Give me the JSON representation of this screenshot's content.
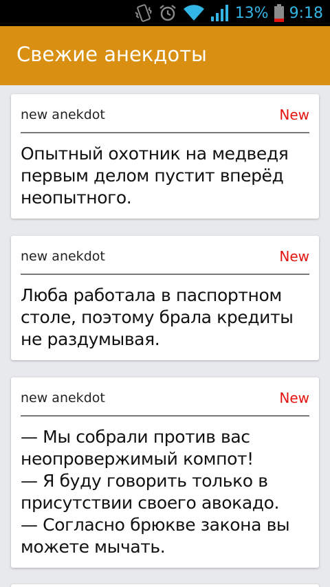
{
  "status_bar": {
    "battery_percent": "13%",
    "time": "9:18",
    "icons": [
      "vibrate-icon",
      "alarm-icon",
      "wifi-icon",
      "signal-icon",
      "battery-icon"
    ],
    "accent_color": "#33b5e5"
  },
  "app_bar": {
    "title": "Свежие анекдоты",
    "color": "#d98f12"
  },
  "cards": [
    {
      "source": "new anekdot",
      "badge": "New",
      "text": "Опытный охотник на медведя первым делом пустит вперёд неопытного."
    },
    {
      "source": "new anekdot",
      "badge": "New",
      "text": "Люба работала в паспортном столе, поэтому брала кредиты не раздумывая."
    },
    {
      "source": "new anekdot",
      "badge": "New",
      "text": "— Мы собрали против вас неопровержимый компот!\n— Я буду говорить только в присутствии своего авокадо.\n— Согласно брюкве закона вы можете мычать."
    }
  ],
  "badge_color": "#e3140f"
}
